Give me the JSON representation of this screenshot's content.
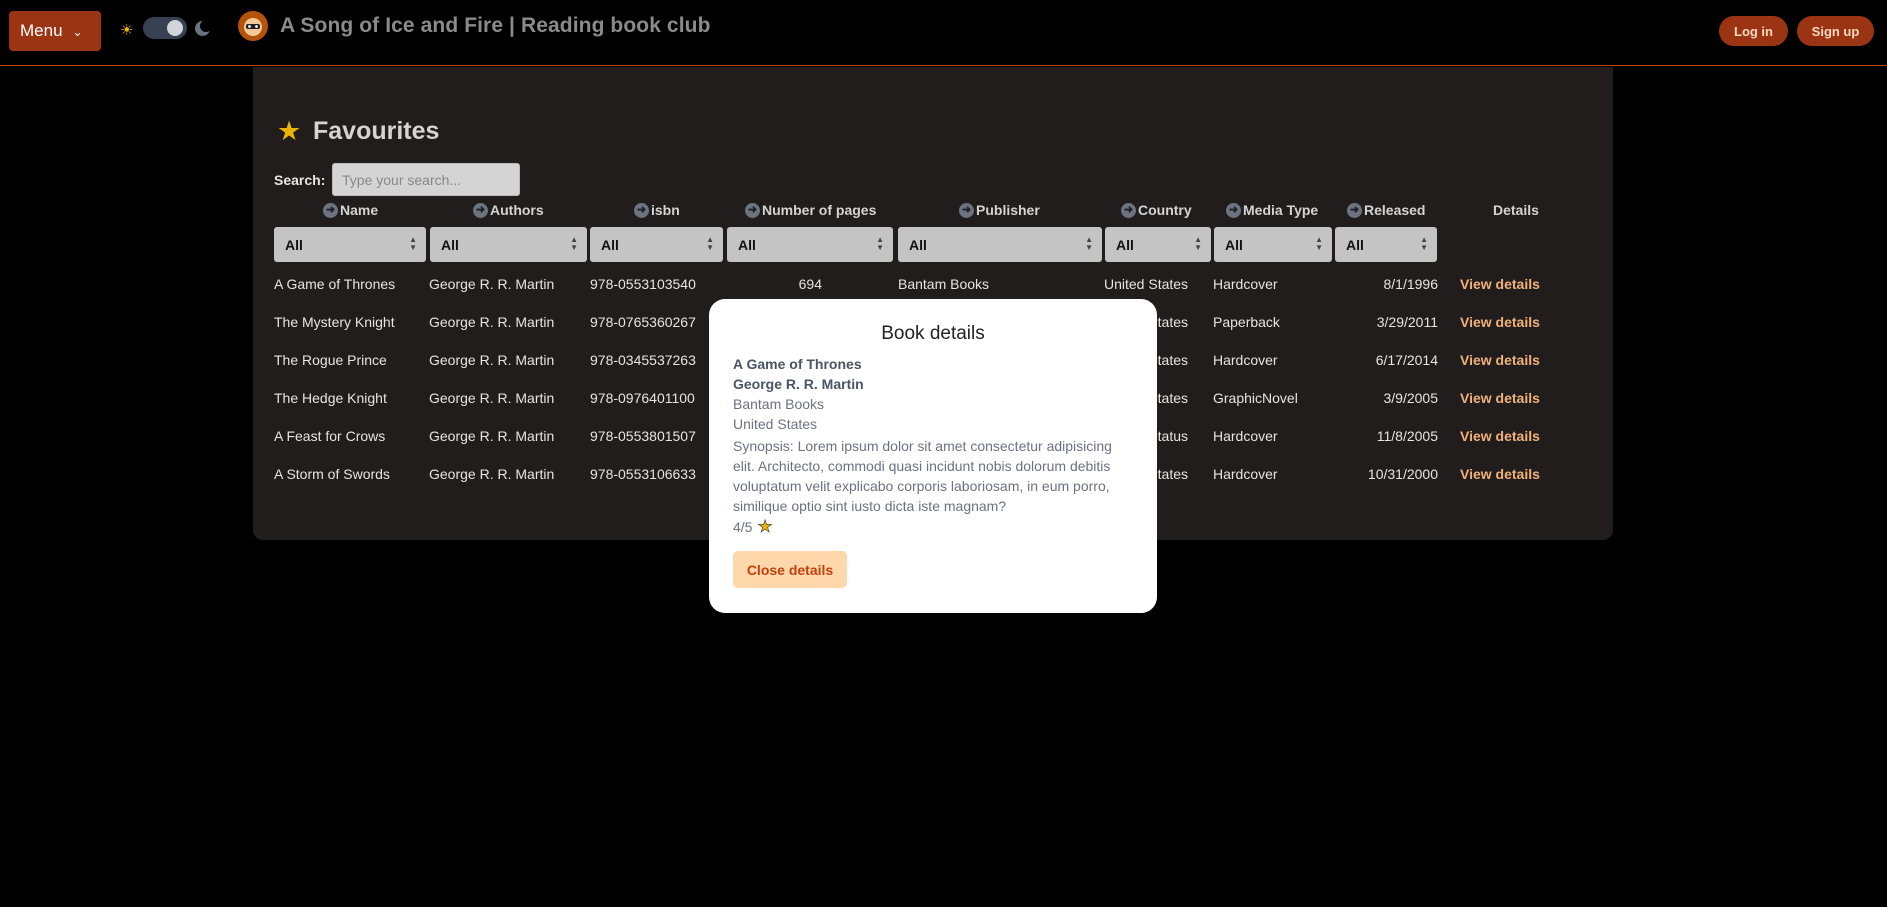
{
  "header": {
    "menu_label": "Menu",
    "site_title": "A Song of Ice and Fire | Reading book club",
    "login_label": "Log in",
    "signup_label": "Sign up"
  },
  "favourites": {
    "title": "Favourites",
    "search_label": "Search:",
    "search_placeholder": "Type your search..."
  },
  "table": {
    "columns": [
      "Name",
      "Authors",
      "isbn",
      "Number of pages",
      "Publisher",
      "Country",
      "Media Type",
      "Released",
      "Details"
    ],
    "filter_value": "All",
    "view_label": "View details",
    "rows": [
      {
        "name": "A Game of Thrones",
        "authors": "George R. R. Martin",
        "isbn": "978-0553103540",
        "pages": "694",
        "publisher": "Bantam Books",
        "country": "United States",
        "media": "Hardcover",
        "released": "8/1/1996"
      },
      {
        "name": "The Mystery Knight",
        "authors": "George R. R. Martin",
        "isbn": "978-0765360267",
        "pages": "",
        "publisher": "",
        "country": "tates",
        "media": "Paperback",
        "released": "3/29/2011"
      },
      {
        "name": "The Rogue Prince",
        "authors": "George R. R. Martin",
        "isbn": "978-0345537263",
        "pages": "",
        "publisher": "",
        "country": "tates",
        "media": "Hardcover",
        "released": "6/17/2014"
      },
      {
        "name": "The Hedge Knight",
        "authors": "George R. R. Martin",
        "isbn": "978-0976401100",
        "pages": "",
        "publisher": "",
        "country": "tates",
        "media": "GraphicNovel",
        "released": "3/9/2005"
      },
      {
        "name": "A Feast for Crows",
        "authors": "George R. R. Martin",
        "isbn": "978-0553801507",
        "pages": "",
        "publisher": "",
        "country": "tatus",
        "media": "Hardcover",
        "released": "11/8/2005"
      },
      {
        "name": "A Storm of Swords",
        "authors": "George R. R. Martin",
        "isbn": "978-0553106633",
        "pages": "",
        "publisher": "",
        "country": "tates",
        "media": "Hardcover",
        "released": "10/31/2000"
      }
    ]
  },
  "modal": {
    "title": "Book details",
    "book_name": "A Game of Thrones",
    "author": "George R. R. Martin",
    "publisher": "Bantam Books",
    "country": "United States",
    "synopsis": "Synopsis: Lorem ipsum dolor sit amet consectetur adipisicing elit. Architecto, commodi quasi incidunt nobis dolorum debitis voluptatum velit explicabo corporis laboriosam, in eum porro, similique optio sint iusto dicta iste magnam?",
    "rating": "4/5",
    "close_label": "Close details"
  },
  "colors": {
    "accent": "#9a3412",
    "link": "#f0b27a",
    "star": "#eab308",
    "panel": "#211d1c"
  }
}
